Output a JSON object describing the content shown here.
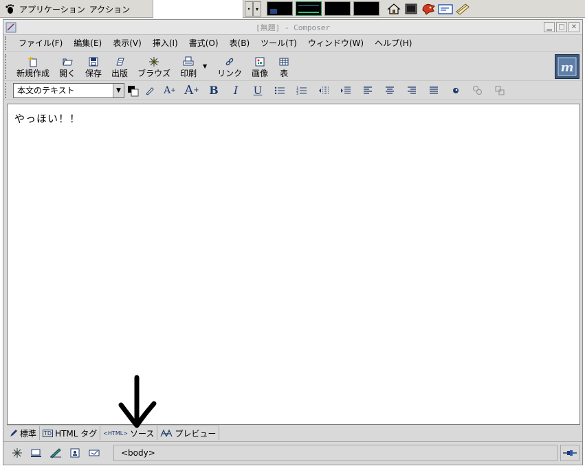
{
  "panel": {
    "applications_label": "アプリケーション",
    "actions_label": "アクション",
    "workspace_count": 4,
    "launchers": [
      "home-folder-icon",
      "terminal-icon",
      "gaim-icon",
      "window-list-icon",
      "notes-icon"
    ]
  },
  "window": {
    "title": "[無題] - Composer"
  },
  "menu": {
    "items": [
      "ファイル(F)",
      "編集(E)",
      "表示(V)",
      "挿入(I)",
      "書式(O)",
      "表(B)",
      "ツール(T)",
      "ウィンドウ(W)",
      "ヘルプ(H)"
    ]
  },
  "toolbar": {
    "new": "新規作成",
    "open": "開く",
    "save": "保存",
    "publish": "出版",
    "browse": "ブラウズ",
    "print": "印刷",
    "link": "リンク",
    "image": "画像",
    "table": "表"
  },
  "format": {
    "paragraph_style": "本文のテキスト",
    "bold": "B",
    "italic": "I",
    "underline": "U"
  },
  "editor": {
    "content": "やっほい！！"
  },
  "modes": {
    "normal": "標準",
    "html_tags": "HTML タグ",
    "source": "ソース",
    "preview": "プレビュー",
    "td_badge": "TD",
    "html_badge": "<HTML>"
  },
  "status": {
    "path": "<body>"
  },
  "colors": {
    "window_bg": "#d9d9d9",
    "icon_blue": "#1e3a6e",
    "throbber_bg": "#3c5a80"
  }
}
